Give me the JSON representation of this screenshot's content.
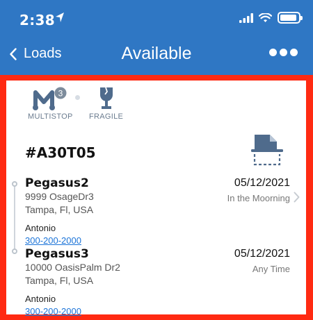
{
  "status_bar": {
    "time": "2:38",
    "battery_level": 0.9
  },
  "nav": {
    "back_label": "Loads",
    "title": "Available"
  },
  "features": [
    {
      "label": "MULTISTOP",
      "badge": "3",
      "icon": "multistop-icon"
    },
    {
      "label": "FRAGILE",
      "icon": "fragile-glass-icon"
    }
  ],
  "load": {
    "id": "#A30T05",
    "stops": [
      {
        "name": "Pegasus2",
        "address1": "9999 OsageDr3",
        "address2": "Tampa, Fl, USA",
        "contact": "Antonio",
        "phone": "300-200-2000",
        "date": "05/12/2021",
        "window": "In the Moorning"
      },
      {
        "name": "Pegasus3",
        "address1": "10000 OasisPalm Dr2",
        "address2": "Tampa, Fl, USA",
        "contact": "Antonio",
        "phone": "300-200-2000",
        "date": "05/12/2021",
        "window": "Any Time"
      }
    ]
  },
  "colors": {
    "nav_bar": "#2f77c4",
    "highlight_frame": "#ff2a12",
    "link": "#1a73d8",
    "icon": "#4f6b8c"
  }
}
